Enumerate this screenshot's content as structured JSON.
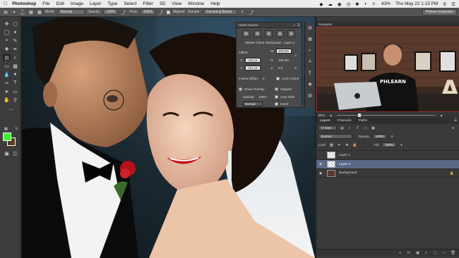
{
  "menubar": {
    "app": "Photoshop",
    "menus": [
      "File",
      "Edit",
      "Image",
      "Layer",
      "Type",
      "Select",
      "Filter",
      "3D",
      "View",
      "Window",
      "Help"
    ],
    "battery": "43%",
    "clock": "Thu May 22  1:15 PM"
  },
  "options": {
    "brush_size": "137",
    "mode_label": "Mode:",
    "mode_value": "Normal",
    "opacity_label": "Opacity:",
    "opacity_value": "100%",
    "flow_label": "Flow:",
    "flow_value": "100%",
    "aligned_label": "Aligned",
    "sample_label": "Sample:",
    "sample_value": "Current & Below",
    "workspace": "Phlearn Episodes"
  },
  "clone_source": {
    "title": "Clone Source",
    "source_name": "Master Clone Stamp.psd - Layer 2",
    "offset_label": "Offset:",
    "w_label": "W:",
    "w_value": "100.0%",
    "h_label": "H:",
    "h_value": "100.0%",
    "x_label": "X:",
    "x_value": "-442 px",
    "y_label": "Y:",
    "y_value": "-121 px",
    "angle_value": "0.0",
    "frame_offset_label": "Frame Offset:",
    "frame_offset_value": "0",
    "lock_frame_label": "Lock Frame",
    "show_overlay_label": "Show Overlay",
    "clipped_label": "Clipped",
    "opacity_label": "Opacity:",
    "opacity_value": "100%",
    "auto_hide_label": "Auto Hide",
    "blend_value": "Normal",
    "invert_label": "Invert"
  },
  "navigator": {
    "title": "Navigator",
    "zoom": "50%",
    "shirt_text": "PHLEARN",
    "sign_letter": "A"
  },
  "layers": {
    "tabs": [
      "Layers",
      "Channels",
      "Paths"
    ],
    "kind_label": "Kind",
    "blend_mode": "Normal",
    "opacity_label": "Opacity:",
    "opacity_value": "100%",
    "lock_label": "Lock:",
    "fill_label": "Fill:",
    "fill_value": "100%",
    "items": [
      {
        "name": "Layer 1",
        "selected": false
      },
      {
        "name": "Layer 2",
        "selected": true
      },
      {
        "name": "Background",
        "selected": false
      }
    ]
  },
  "colors": {
    "foreground": "#3df02c",
    "background": "#5a3b1f",
    "selected_layer": "#5a6a86"
  }
}
